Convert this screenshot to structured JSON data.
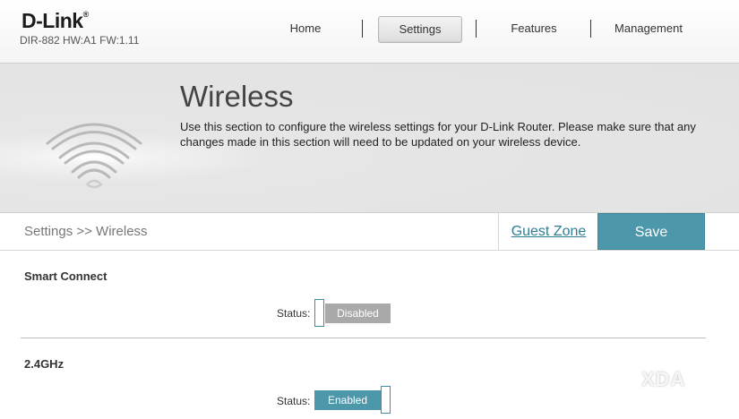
{
  "header": {
    "logo": "D-Link",
    "logo_mark": "®",
    "model": "DIR-882 HW:A1 FW:1.11",
    "nav": [
      {
        "label": "Home"
      },
      {
        "label": "Settings",
        "active": true
      },
      {
        "label": "Features"
      },
      {
        "label": "Management"
      }
    ]
  },
  "hero": {
    "title": "Wireless",
    "description": "Use this section to configure the wireless settings for your D-Link Router. Please make sure that any changes made in this section will need to be updated on your wireless device.",
    "icon": "wifi-icon"
  },
  "breadcrumb": {
    "text": "Settings >> Wireless",
    "guest_zone_label": "Guest Zone",
    "save_label": "Save"
  },
  "sections": {
    "smart_connect": {
      "title": "Smart Connect",
      "status_label": "Status:",
      "toggle_text": "Disabled",
      "enabled": false
    },
    "band_24": {
      "title": "2.4GHz",
      "status_label": "Status:",
      "toggle_text": "Enabled",
      "enabled": true
    }
  },
  "watermark": "XDA",
  "colors": {
    "accent": "#4d97aa",
    "disabled": "#a9a9a9",
    "link": "#2f7d94"
  }
}
